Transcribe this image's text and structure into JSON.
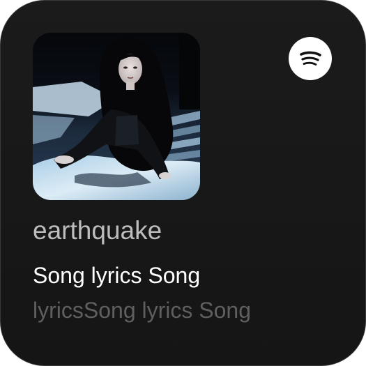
{
  "widget": {
    "app_icon": "spotify-icon",
    "cover_art": "album-cover-image",
    "track_title": "earthquake",
    "lyrics": {
      "current_line": "Song lyrics Song",
      "next_line": "lyricsSong lyrics Song"
    },
    "colors": {
      "background": "#181818",
      "title": "#bdbdbd",
      "current_line": "#ffffff",
      "next_line": "#5f5f5f",
      "badge": "#ffffff"
    }
  }
}
